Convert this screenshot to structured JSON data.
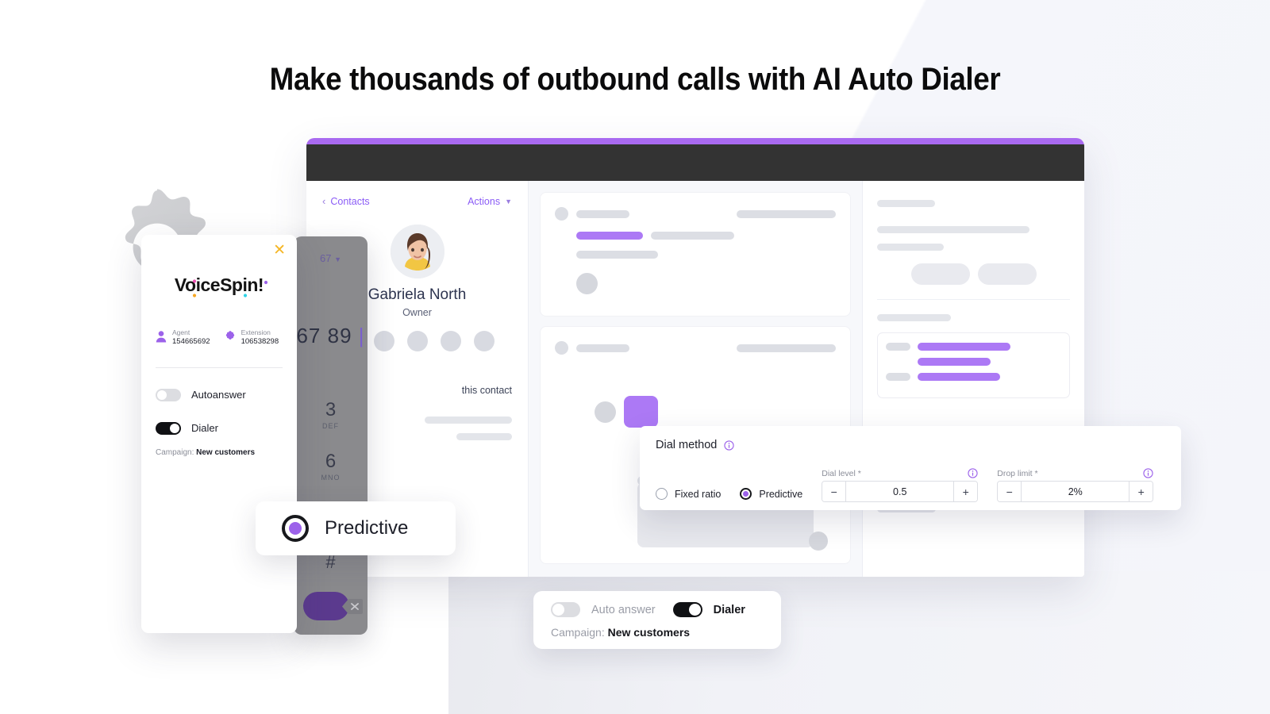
{
  "headline": "Make thousands of outbound calls with AI Auto Dialer",
  "brand": {
    "accent": "#a96af0",
    "dark_header": "#333333",
    "logo_text": "VoiceSpin!"
  },
  "contact_panel": {
    "back_label": "Contacts",
    "actions_label": "Actions",
    "name": "Gabriela North",
    "role": "Owner",
    "sub_text": "this contact"
  },
  "dialpad": {
    "number_top": "67",
    "typed_number": "67 89",
    "keys": [
      {
        "digit": "3",
        "letters": "DEF"
      },
      {
        "digit": "6",
        "letters": "MNO"
      }
    ],
    "hash": "#"
  },
  "voicespin_card": {
    "close_icon": "close-icon",
    "logo": "VoiceSpin!",
    "agent_label": "Agent",
    "agent_value": "154665692",
    "extension_label": "Extension",
    "extension_value": "106538298",
    "autoanswer_label": "Autoanswer",
    "autoanswer_state": "off",
    "dialer_label": "Dialer",
    "dialer_state": "on",
    "campaign_label": "Campaign:",
    "campaign_value": "New customers"
  },
  "predictive_pill": {
    "label": "Predictive",
    "selected": true
  },
  "dial_method": {
    "title": "Dial method",
    "option_fixed": "Fixed ratio",
    "option_predictive": "Predictive",
    "selected": "Predictive",
    "dial_level_label": "Dial level *",
    "dial_level_value": "0.5",
    "drop_limit_label": "Drop limit *",
    "drop_limit_value": "2%",
    "minus": "−",
    "plus": "+"
  },
  "bottom_card": {
    "auto_answer_label": "Auto answer",
    "auto_answer_state": "off",
    "dialer_label": "Dialer",
    "dialer_state": "on",
    "campaign_label": "Campaign:",
    "campaign_value": "New customers"
  }
}
